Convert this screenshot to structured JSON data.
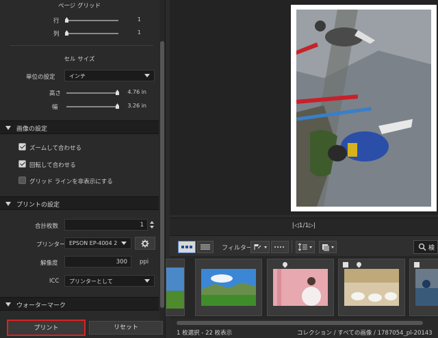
{
  "page_grid": {
    "title": "ページ グリッド",
    "row_label": "行",
    "row_value": "1",
    "col_label": "列",
    "col_value": "1"
  },
  "cell_size": {
    "title": "セル サイズ",
    "unit_label": "単位の設定",
    "unit_value": "インチ",
    "height_label": "高さ",
    "height_value": "4.76 in",
    "width_label": "幅",
    "width_value": "3.26 in"
  },
  "image_settings": {
    "title": "画像の設定",
    "zoom_fit": "ズームして合わせる",
    "rotate_fit": "回転して合わせる",
    "hide_grid": "グリッド ラインを非表示にする",
    "zoom_fit_checked": true,
    "rotate_fit_checked": true,
    "hide_grid_checked": false
  },
  "print_settings": {
    "title": "プリントの設定",
    "copies_label": "合計枚数",
    "copies_value": "1",
    "printer_label": "プリンター",
    "printer_value": "EPSON EP-4004 2",
    "resolution_label": "解像度",
    "resolution_value": "300",
    "resolution_unit": "ppi",
    "icc_label": "ICC",
    "icc_value": "プリンターとして"
  },
  "watermark": {
    "title": "ウォーターマーク"
  },
  "buttons": {
    "print": "プリント",
    "reset": "リセット"
  },
  "pager": {
    "text": "|◁1/1▷|"
  },
  "toolbar": {
    "filter_label": "フィルター:",
    "search_label": "検"
  },
  "status": {
    "left": "1 枚選択 - 22 枚表示",
    "right": "コレクション / すべての画像 / 1787054_pl-20143"
  },
  "colors": {
    "accent_red": "#e0201f",
    "panel": "#2a2a2a",
    "section": "#1e1e1e"
  }
}
